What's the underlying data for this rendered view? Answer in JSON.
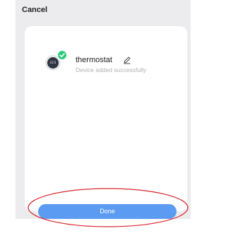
{
  "header": {
    "cancel_label": "Cancel"
  },
  "device": {
    "icon": "thermostat-icon",
    "display_value": "23.5",
    "badge_icon": "check-icon",
    "name": "thermostat",
    "edit_icon": "pencil-icon",
    "status": "Device added successfully"
  },
  "footer": {
    "done_label": "Done"
  },
  "colors": {
    "primary_button": "#5b9cf2",
    "success_badge": "#2bcb7a",
    "annotation": "#d9262c"
  }
}
